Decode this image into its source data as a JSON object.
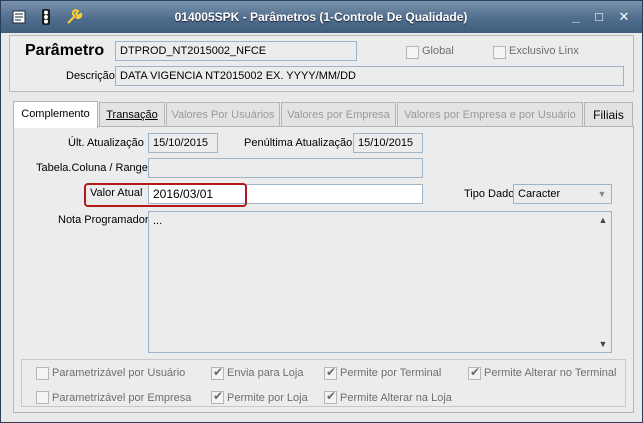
{
  "window": {
    "title": "014005SPK - Parâmetros (1-Controle De Qualidade)",
    "controls": {
      "minimize": "_",
      "maximize": "□",
      "close": "✕"
    }
  },
  "header": {
    "parametro_label": "Parâmetro",
    "parametro_value": "DTPROD_NT2015002_NFCE",
    "descricao_label": "Descrição",
    "descricao_value": "DATA VIGENCIA NT2015002 EX. YYYY/MM/DD",
    "global_label": "Global",
    "exclusivo_label": "Exclusivo Linx"
  },
  "tabs": [
    {
      "label": "Complemento",
      "state": "active"
    },
    {
      "label": "Transação",
      "state": "enabled"
    },
    {
      "label": "Valores Por Usuários",
      "state": "disabled"
    },
    {
      "label": "Valores por Empresa",
      "state": "disabled"
    },
    {
      "label": "Valores por Empresa e por Usuário",
      "state": "disabled"
    },
    {
      "label": "Filiais",
      "state": "enabled"
    }
  ],
  "complemento": {
    "ult_atualizacao_label": "Últ. Atualização",
    "ult_atualizacao_value": "15/10/2015",
    "penultima_label": "Penúltima Atualização",
    "penultima_value": "15/10/2015",
    "tabela_label": "Tabela.Coluna / Range",
    "tabela_value": "",
    "valor_atual_label": "Valor Atual",
    "valor_atual_value": "2016/03/01",
    "tipo_dado_label": "Tipo Dado",
    "tipo_dado_value": "Caracter",
    "nota_label": "Nota Programador",
    "nota_value": "..."
  },
  "options": {
    "parametrizavel_usuario": "Parametrizável por Usuário",
    "envia_loja": "Envia para Loja",
    "permite_terminal": "Permite por Terminal",
    "permite_alterar_terminal": "Permite Alterar no Terminal",
    "parametrizavel_empresa": "Parametrizável por Empresa",
    "permite_loja": "Permite por Loja",
    "permite_alterar_loja": "Permite Alterar na Loja"
  },
  "colors": {
    "titlebar": "#4f6d8c",
    "highlight": "#b21a1a"
  }
}
